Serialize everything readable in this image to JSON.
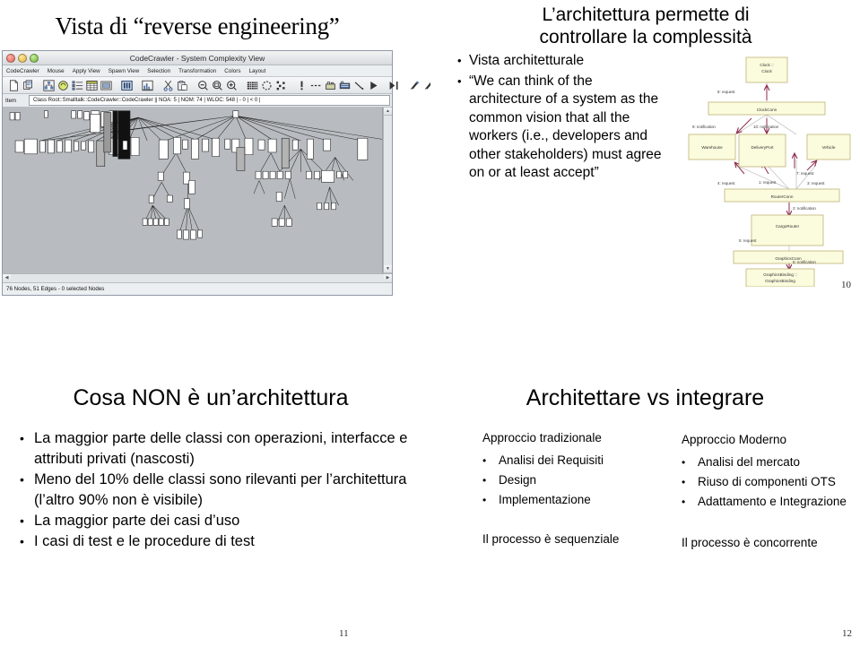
{
  "slide_reverse_engineering": {
    "number": "10",
    "title": "Vista di “reverse engineering”",
    "app": {
      "window_title": "CodeCrawler - System Complexity View",
      "menu_items": [
        "CodeCrawler",
        "Mouse",
        "Apply View",
        "Spawn View",
        "Selection",
        "Transformation",
        "Colors",
        "Layout"
      ],
      "toolbar_icons": [
        "new-document-icon",
        "copy-document-icon",
        "layout-tree-icon",
        "refresh-circle-icon",
        "list-view-icon",
        "table-view-icon",
        "image-view-icon",
        "columns-view-icon",
        "histogram-view-icon",
        "cut-scissors-icon",
        "paste-icon",
        "zoom-out-icon",
        "zoom-fit-icon",
        "zoom-in-icon",
        "grid-icon",
        "circle-layout-icon",
        "scatter-layout-icon",
        "info-exclamation-icon",
        "edge-style-icon",
        "node-metric-icon",
        "color-palette-icon",
        "line-tool-icon",
        "play-icon",
        "collapse-icon",
        "wand-left-icon",
        "wand-right-icon"
      ],
      "item_label": "Item",
      "item_value": "Class Root::Smalltalk::CodeCrawler::CodeCrawler || NOA: 5 | NOM: 74 | WLOC: 548 | - 0 | < 0 |",
      "status_text": "76 Nodes, 51 Edges - 0 selected Nodes"
    }
  },
  "slide_complessita": {
    "number": "10",
    "title_lines": [
      "L’architettura permette di",
      "controllare la complessità"
    ],
    "bullets": [
      "Vista architetturale",
      "“We can think of the architecture of a system as the common vision that all the workers (i.e., developers and other stakeholders) must agree on or at least accept”"
    ],
    "diagram": {
      "type": "uml-component-collaboration",
      "node_fill": "#fbfbdd",
      "node_stroke": "#b9a96e",
      "arrow_color": "#8c2b4d",
      "nodes": [
        {
          "id": "clock",
          "label_lines": [
            "Clock ::",
            "Clock"
          ]
        },
        {
          "id": "clockconn",
          "label_lines": [
            "ClockConn"
          ]
        },
        {
          "id": "warehouse",
          "label_lines": [
            "Warehouse"
          ]
        },
        {
          "id": "deliveryport",
          "label_lines": [
            "DeliveryPort"
          ]
        },
        {
          "id": "vehicle",
          "label_lines": [
            "Vehicle"
          ]
        },
        {
          "id": "routerconn",
          "label_lines": [
            "RouterConn"
          ]
        },
        {
          "id": "cargorouter",
          "label_lines": [
            "CargoRouter"
          ]
        },
        {
          "id": "graphicsconn",
          "label_lines": [
            "GraphicsConn"
          ]
        },
        {
          "id": "graphicsbinding",
          "label_lines": [
            "GraphicsBinding ::",
            "GraphicsBinding"
          ]
        }
      ],
      "edge_labels": [
        "8: request",
        "9: notification",
        "10: notification",
        "7: request",
        "4: request",
        "1: request",
        "3: request",
        "2: notification",
        "5: request",
        "6: notification"
      ]
    }
  },
  "slide_cosa_non": {
    "number": "11",
    "title": "Cosa NON è un’architettura",
    "bullets": [
      "La maggior parte delle classi con operazioni, interfacce e attributi privati (nascosti)",
      "Meno del 10% delle classi sono rilevanti per l’architettura (l’altro 90% non è visibile)",
      "La maggior parte dei casi d’uso",
      "I casi di test e le procedure di test"
    ]
  },
  "slide_architettare": {
    "number": "12",
    "title": "Architettare vs integrare",
    "left_column": {
      "heading": "Approccio tradizionale",
      "items": [
        "Analisi dei Requisiti",
        "Design",
        "Implementazione"
      ],
      "footer": "Il processo è sequenziale"
    },
    "right_column": {
      "heading": "Approccio Moderno",
      "items": [
        "Analisi del mercato",
        "Riuso di componenti OTS",
        "Adattamento e Integrazione"
      ],
      "footer": "Il processo è concorrente"
    }
  },
  "symbols": {
    "bullet": "•",
    "scroll_up": "▲",
    "scroll_down": "▼",
    "scroll_left": "◀",
    "scroll_right": "▶"
  }
}
